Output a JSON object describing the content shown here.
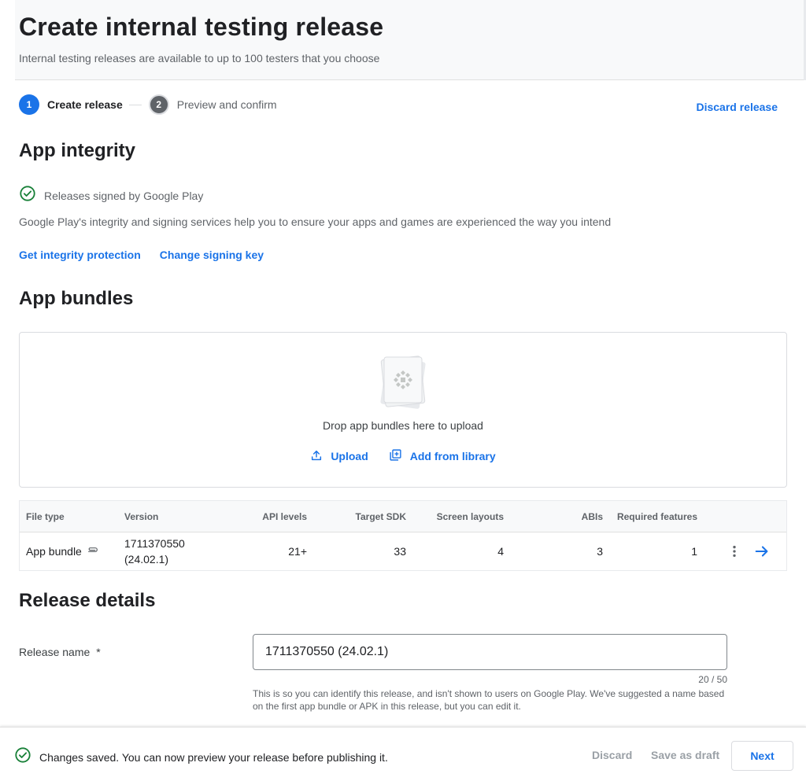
{
  "header": {
    "title": "Create internal testing release",
    "subtitle": "Internal testing releases are available to up to 100 testers that you choose"
  },
  "stepper": {
    "steps": [
      {
        "number": "1",
        "label": "Create release",
        "state": "active"
      },
      {
        "number": "2",
        "label": "Preview and confirm",
        "state": "inactive"
      }
    ]
  },
  "discard_release_label": "Discard release",
  "app_integrity": {
    "title": "App integrity",
    "status_icon": "check-circle-icon",
    "status_text": "Releases signed by Google Play",
    "description": "Google Play's integrity and signing services help you to ensure your apps and games are experienced the way you intend",
    "links": [
      "Get integrity protection",
      "Change signing key"
    ]
  },
  "app_bundles": {
    "title": "App bundles",
    "drop_text": "Drop app bundles here to upload",
    "upload_label": "Upload",
    "upload_icon": "upload-icon",
    "library_label": "Add from library",
    "library_icon": "add-to-library-icon",
    "table": {
      "columns": [
        "File type",
        "Version",
        "API levels",
        "Target SDK",
        "Screen layouts",
        "ABIs",
        "Required features"
      ],
      "rows": [
        {
          "file_type": "App bundle",
          "file_icon": "paperclip-icon",
          "version_line1": "1711370550",
          "version_line2": "(24.02.1)",
          "api_levels": "21+",
          "target_sdk": "33",
          "screen_layouts": "4",
          "abis": "3",
          "required_features": "1",
          "menu_icon": "more-vert-icon",
          "open_icon": "arrow-forward-icon"
        }
      ]
    }
  },
  "release_details": {
    "title": "Release details",
    "name_label": "Release name",
    "required_mark": "*",
    "name_value": "1711370550 (24.02.1)",
    "counter": "20 / 50",
    "helper": "This is so you can identify this release, and isn't shown to users on Google Play. We've suggested a name based on the first app bundle or APK in this release, but you can edit it."
  },
  "footer": {
    "status_icon": "check-circle-icon",
    "status_text": "Changes saved. You can now preview your release before publishing it.",
    "discard_label": "Discard",
    "save_draft_label": "Save as draft",
    "next_label": "Next"
  },
  "colors": {
    "accent": "#1a73e8",
    "success": "#188038",
    "text_secondary": "#5f6368",
    "disabled": "#9aa0a6"
  }
}
